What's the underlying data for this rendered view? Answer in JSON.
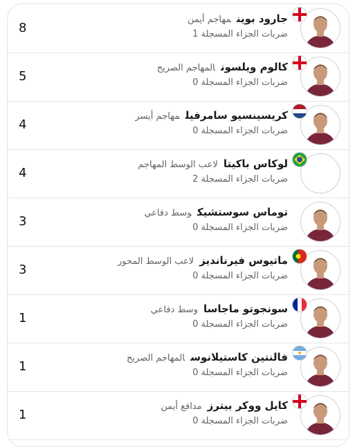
{
  "players": [
    {
      "name": "جارود بوين",
      "position": "مهاجم أيمن",
      "stat_label": "ضربات الجزاء المسجلة",
      "stat_value": "1",
      "count": "8",
      "flag": "england",
      "photo": true
    },
    {
      "name": "كالوم ويلسون",
      "position": "المهاجم الصريح",
      "stat_label": "ضربات الجزاء المسجلة",
      "stat_value": "0",
      "count": "5",
      "flag": "england",
      "photo": true
    },
    {
      "name": "كريسينسيو سامرفيل",
      "position": "مهاجم أيسر",
      "stat_label": "ضربات الجزاء المسجلة",
      "stat_value": "0",
      "count": "4",
      "flag": "netherlands",
      "photo": true
    },
    {
      "name": "لوكاس باكيتا",
      "position": "لاعب الوسط المهاجم",
      "stat_label": "ضربات الجزاء المسجلة",
      "stat_value": "2",
      "count": "4",
      "flag": "brazil",
      "photo": false
    },
    {
      "name": "توماس سوستشيك",
      "position": "وسط دفاعي",
      "stat_label": "ضربات الجزاء المسجلة",
      "stat_value": "0",
      "count": "3",
      "flag": "",
      "photo": true
    },
    {
      "name": "ماتيوس فيرنانديز",
      "position": "لاعب الوسط المحور",
      "stat_label": "ضربات الجزاء المسجلة",
      "stat_value": "0",
      "count": "3",
      "flag": "portugal",
      "photo": true
    },
    {
      "name": "سونجوتو ماجاسا",
      "position": "وسط دفاعي",
      "stat_label": "ضربات الجزاء المسجلة",
      "stat_value": "0",
      "count": "1",
      "flag": "france",
      "photo": true
    },
    {
      "name": "فالنتين كاستيلانوس",
      "position": "المهاجم الصريح",
      "stat_label": "ضربات الجزاء المسجلة",
      "stat_value": "0",
      "count": "1",
      "flag": "argentina",
      "photo": true
    },
    {
      "name": "كايل ووكر بيترز",
      "position": "مدافع أيمن",
      "stat_label": "ضربات الجزاء المسجلة",
      "stat_value": "0",
      "count": "1",
      "flag": "england",
      "photo": true
    }
  ],
  "colors": {
    "kit": "#7a263a",
    "skin": "#c99a7a",
    "hair": "#3b2a20",
    "border": "#e6e6e6"
  }
}
